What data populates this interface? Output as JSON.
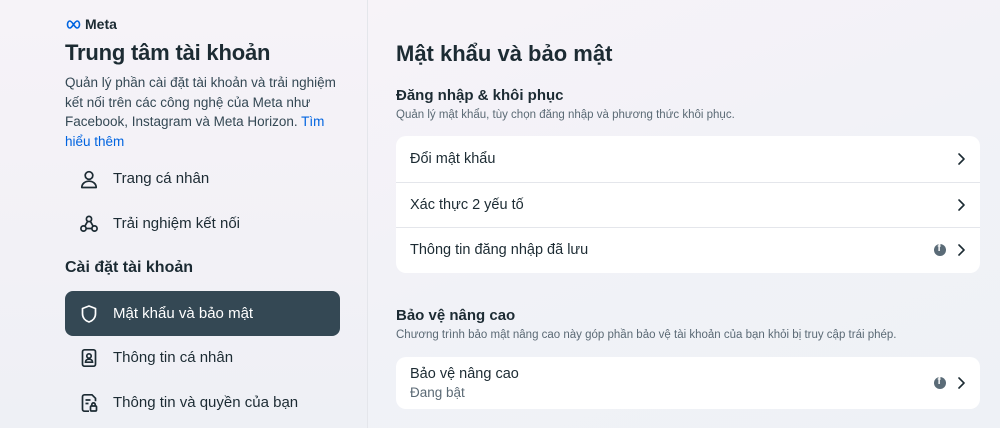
{
  "sidebar": {
    "logo_text": "Meta",
    "title": "Trung tâm tài khoản",
    "description": "Quản lý phần cài đặt tài khoản và trải nghiệm kết nối trên các công nghệ của Meta như Facebook, Instagram và Meta Horizon.",
    "learn_more": "Tìm hiểu thêm",
    "items": [
      {
        "label": "Trang cá nhân",
        "icon": "person-icon"
      },
      {
        "label": "Trải nghiệm kết nối",
        "icon": "connected-icon"
      }
    ],
    "section_title": "Cài đặt tài khoản",
    "settings_items": [
      {
        "label": "Mật khẩu và bảo mật",
        "icon": "shield-icon",
        "active": true
      },
      {
        "label": "Thông tin cá nhân",
        "icon": "id-card-icon",
        "active": false
      },
      {
        "label": "Thông tin và quyền của bạn",
        "icon": "document-lock-icon",
        "active": false
      }
    ]
  },
  "main": {
    "title": "Mật khẩu và bảo mật",
    "login_section": {
      "title": "Đăng nhập & khôi phục",
      "subtitle": "Quản lý mật khẩu, tùy chọn đăng nhập và phương thức khôi phục.",
      "rows": [
        {
          "label": "Đổi mật khẩu"
        },
        {
          "label": "Xác thực 2 yếu tố"
        },
        {
          "label": "Thông tin đăng nhập đã lưu",
          "badge": "facebook-icon"
        }
      ]
    },
    "advanced_section": {
      "title": "Bảo vệ nâng cao",
      "subtitle": "Chương trình bảo mật nâng cao này góp phần bảo vệ tài khoản của bạn khỏi bị truy cập trái phép.",
      "row_label": "Bảo vệ nâng cao",
      "row_status": "Đang bật",
      "badge": "facebook-icon"
    }
  },
  "colors": {
    "active_bg": "#344854",
    "link": "#0064e0",
    "text": "#1c2b33"
  }
}
